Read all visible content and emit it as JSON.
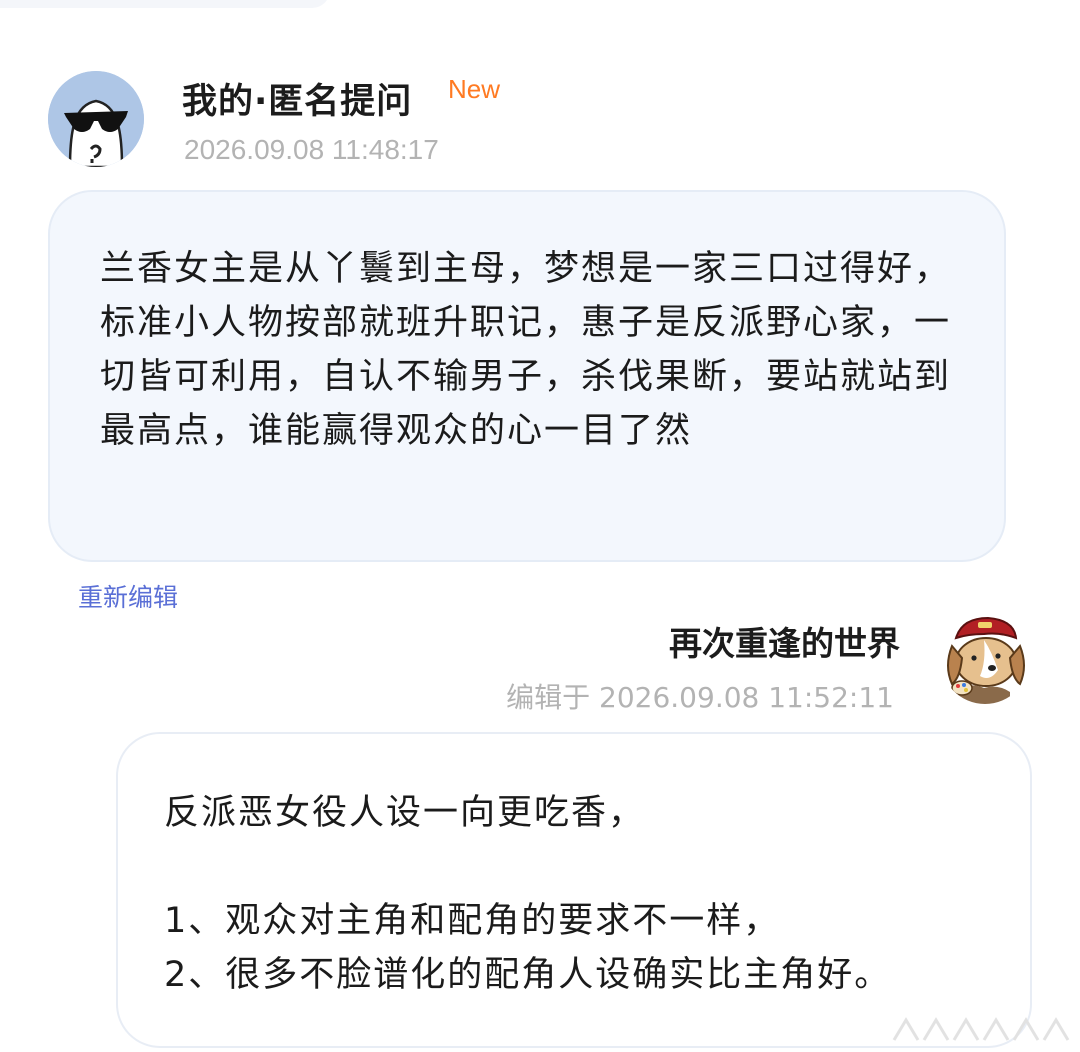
{
  "question": {
    "user_name": "我的·匿名提问",
    "badge": "New",
    "timestamp": "2026.09.08 11:48:17",
    "text": "兰香女主是从丫鬟到主母，梦想是一家三口过得好，标准小人物按部就班升职记，惠子是反派野心家，一切皆可利用，自认不输男子，杀伐果断，要站就站到最高点，谁能赢得观众的心一目了然",
    "reedit_label": "重新编辑"
  },
  "answer": {
    "user_name": "再次重逢的世界",
    "timestamp": "编辑于 2026.09.08 11:52:11",
    "lines": [
      "反派恶女役人设一向更吃香，",
      "1、观众对主角和配角的要求不一样，",
      "2、很多不脸谱化的配角人设确实比主角好。"
    ]
  },
  "colors": {
    "accent_new": "#ff7a22",
    "reedit_link": "#5a6fd6",
    "question_bubble_bg": "#f3f7fd",
    "timestamp": "#b3b3b3"
  },
  "icons": {
    "question_avatar": "anonymous-sunglasses-avatar",
    "answer_avatar": "dog-painter-avatar"
  }
}
